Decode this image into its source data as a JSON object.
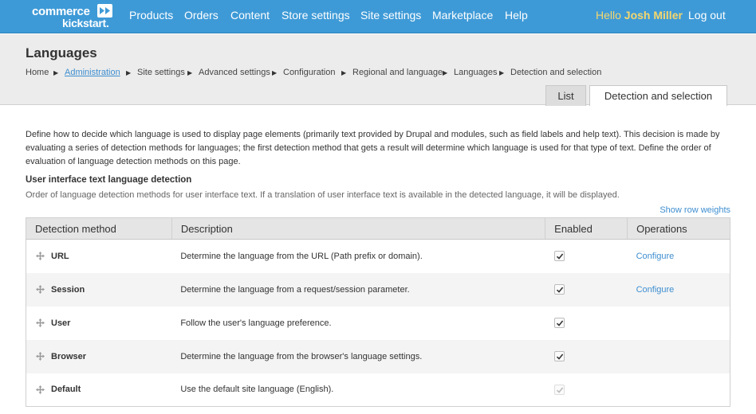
{
  "topbar": {
    "logo_line1": "commerce",
    "logo_line2": "kickstart.",
    "nav": [
      "Products",
      "Orders",
      "Content",
      "Store settings",
      "Site settings",
      "Marketplace",
      "Help"
    ],
    "hello_prefix": "Hello",
    "user_name": "Josh Miller",
    "logout": "Log out"
  },
  "header": {
    "title": "Languages",
    "breadcrumb": [
      "Home",
      "Administration",
      "Site settings",
      "Advanced settings",
      "Configuration",
      "Regional and language",
      "Languages",
      "Detection and selection"
    ],
    "tabs": [
      "List",
      "Detection and selection"
    ]
  },
  "main": {
    "intro": "Define how to decide which language is used to display page elements (primarily text provided by Drupal and modules, such as field labels and help text). This decision is made by evaluating a series of detection methods for languages; the first detection method that gets a result will determine which language is used for that type of text. Define the order of evaluation of language detection methods on this page.",
    "section_title": "User interface text language detection",
    "section_desc": "Order of language detection methods for user interface text. If a translation of user interface text is available in the detected language, it will be displayed.",
    "show_weights": "Show row weights",
    "table": {
      "headers": [
        "Detection method",
        "Description",
        "Enabled",
        "Operations"
      ],
      "rows": [
        {
          "method": "URL",
          "description": "Determine the language from the URL (Path prefix or domain).",
          "enabled": true,
          "disabled": false,
          "operation": "Configure"
        },
        {
          "method": "Session",
          "description": "Determine the language from a request/session parameter.",
          "enabled": true,
          "disabled": false,
          "operation": "Configure"
        },
        {
          "method": "User",
          "description": "Follow the user's language preference.",
          "enabled": true,
          "disabled": false,
          "operation": ""
        },
        {
          "method": "Browser",
          "description": "Determine the language from the browser's language settings.",
          "enabled": true,
          "disabled": false,
          "operation": ""
        },
        {
          "method": "Default",
          "description": "Use the default site language (English).",
          "enabled": true,
          "disabled": true,
          "operation": ""
        }
      ]
    }
  },
  "colors": {
    "topbar": "#3e9ad7",
    "link": "#3e8ed0",
    "hello": "#f5d76e"
  }
}
